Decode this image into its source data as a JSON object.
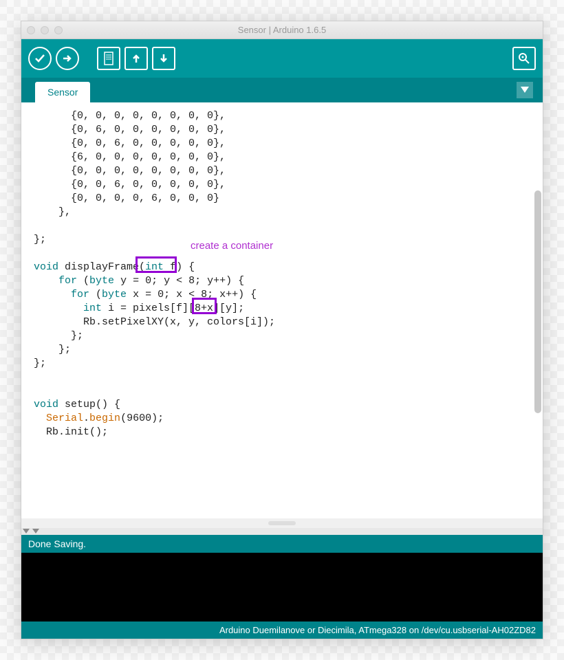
{
  "window": {
    "title": "Sensor | Arduino 1.6.5"
  },
  "toolbar": {
    "verify": "Verify",
    "upload": "Upload",
    "new": "New",
    "open": "Open",
    "save": "Save",
    "serial": "Serial Monitor"
  },
  "tab": {
    "name": "Sensor"
  },
  "annotation": {
    "label": "create a container"
  },
  "code": {
    "lines": [
      {
        "indent": 3,
        "raw": "{0, 0, 0, 0, 0, 0, 0, 0},"
      },
      {
        "indent": 3,
        "raw": "{0, 6, 0, 0, 0, 0, 0, 0},"
      },
      {
        "indent": 3,
        "raw": "{0, 0, 6, 0, 0, 0, 0, 0},"
      },
      {
        "indent": 3,
        "raw": "{6, 0, 0, 0, 0, 0, 0, 0},"
      },
      {
        "indent": 3,
        "raw": "{0, 0, 0, 0, 0, 0, 0, 0},"
      },
      {
        "indent": 3,
        "raw": "{0, 0, 6, 0, 0, 0, 0, 0},"
      },
      {
        "indent": 3,
        "raw": "{0, 0, 0, 0, 6, 0, 0, 0}"
      },
      {
        "indent": 2,
        "raw": "},"
      },
      {
        "indent": 0,
        "raw": ""
      },
      {
        "indent": 0,
        "raw": "};"
      },
      {
        "indent": 0,
        "raw": ""
      },
      {
        "indent": 0,
        "type": "fn_def",
        "parts": [
          "void",
          " displayFrame(",
          "int",
          " f) {"
        ]
      },
      {
        "indent": 2,
        "type": "for",
        "parts": [
          "for",
          " (",
          "byte",
          " y = 0; y < 8; y++) {"
        ]
      },
      {
        "indent": 3,
        "type": "for",
        "parts": [
          "for",
          " (",
          "byte",
          " x = 0; x < 8; x++) {"
        ]
      },
      {
        "indent": 4,
        "type": "decl",
        "parts": [
          "int",
          " i = pixels[f][8+x][y];"
        ]
      },
      {
        "indent": 4,
        "raw": "Rb.setPixelXY(x, y, colors[i]);"
      },
      {
        "indent": 3,
        "raw": "};"
      },
      {
        "indent": 2,
        "raw": "};"
      },
      {
        "indent": 0,
        "raw": "};"
      },
      {
        "indent": 0,
        "raw": ""
      },
      {
        "indent": 0,
        "raw": ""
      },
      {
        "indent": 0,
        "type": "fn_def",
        "parts": [
          "void",
          " setup() {"
        ]
      },
      {
        "indent": 1,
        "type": "call",
        "parts": [
          "Serial",
          ".",
          "begin",
          "(9600);"
        ]
      },
      {
        "indent": 1,
        "raw": "Rb.init();"
      }
    ]
  },
  "status": {
    "message": "Done Saving."
  },
  "bottombar": {
    "board": "Arduino Duemilanove or Diecimila, ATmega328 on /dev/cu.usbserial-AH02ZD82"
  }
}
